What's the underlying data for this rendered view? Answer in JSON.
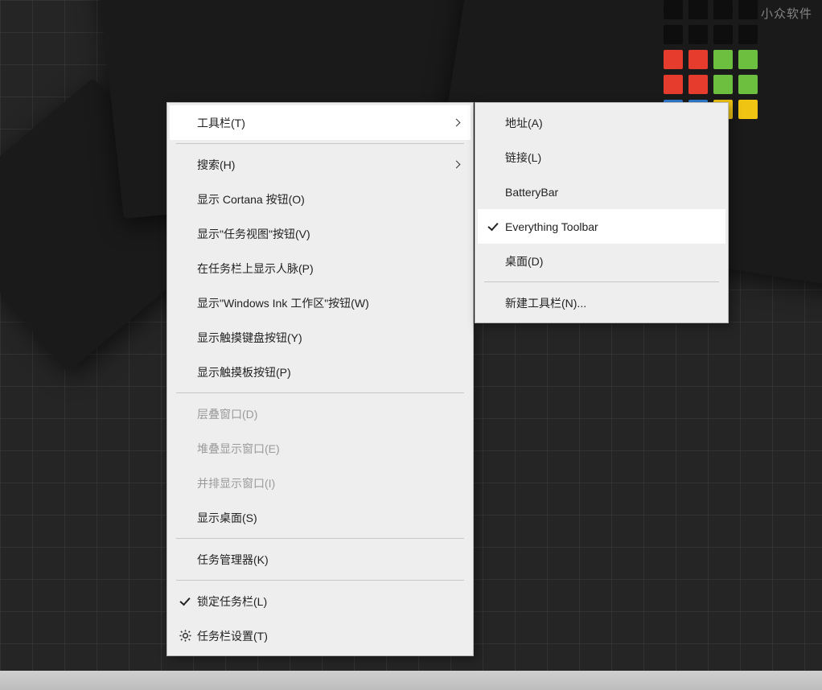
{
  "watermark": "小众软件",
  "main_menu": {
    "toolbars": "工具栏(T)",
    "search": "搜索(H)",
    "show_cortana": "显示 Cortana 按钮(O)",
    "show_task_view": "显示\"任务视图\"按钮(V)",
    "show_people": "在任务栏上显示人脉(P)",
    "show_ink": "显示\"Windows Ink 工作区\"按钮(W)",
    "show_touch_keyboard": "显示触摸键盘按钮(Y)",
    "show_touchpad": "显示触摸板按钮(P)",
    "cascade": "层叠窗口(D)",
    "stacked": "堆叠显示窗口(E)",
    "sidebyside": "并排显示窗口(I)",
    "show_desktop": "显示桌面(S)",
    "task_manager": "任务管理器(K)",
    "lock_taskbar": "锁定任务栏(L)",
    "taskbar_settings": "任务栏设置(T)"
  },
  "sub_menu": {
    "address": "地址(A)",
    "links": "链接(L)",
    "batterybar": "BatteryBar",
    "everything": "Everything Toolbar",
    "desktop": "桌面(D)",
    "new_toolbar": "新建工具栏(N)..."
  }
}
